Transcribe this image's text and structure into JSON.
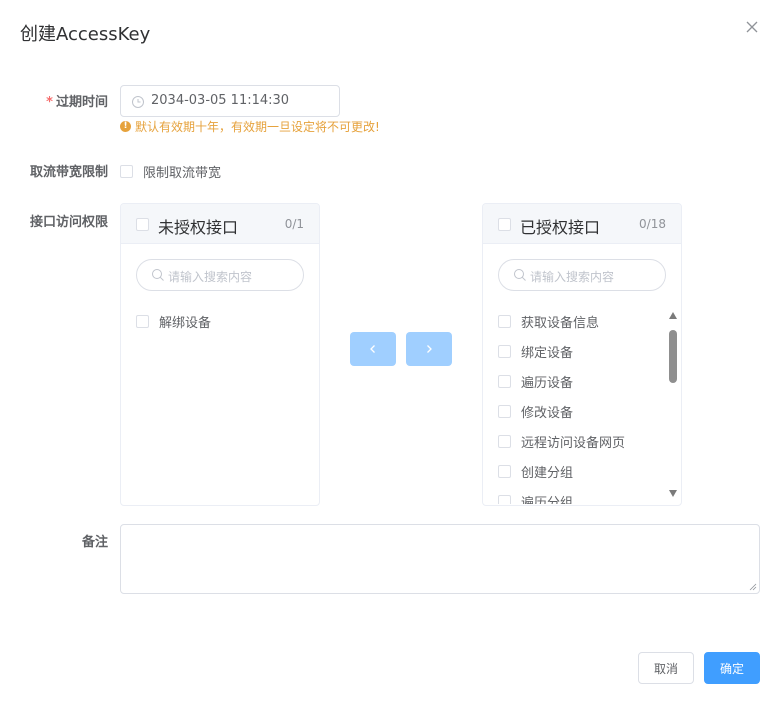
{
  "dialog": {
    "title": "创建AccessKey",
    "close_icon": "close-icon"
  },
  "form": {
    "expire": {
      "required_mark": "*",
      "label": "过期时间",
      "value": "2034-03-05 11:14:30",
      "icon": "clock-icon",
      "warning": "默认有效期十年，有效期一旦设定将不可更改!",
      "warning_icon": "warning-icon",
      "warning_color": "#e6a23c"
    },
    "bandwidth": {
      "label": "取流带宽限制",
      "checkbox_label": "限制取流带宽",
      "checked": false
    },
    "api_access": {
      "label": "接口访问权限",
      "left_panel": {
        "title": "未授权接口",
        "count": "0/1",
        "search_placeholder": "请输入搜索内容",
        "items": [
          "解绑设备"
        ]
      },
      "right_panel": {
        "title": "已授权接口",
        "count": "0/18",
        "search_placeholder": "请输入搜索内容",
        "items": [
          "获取设备信息",
          "绑定设备",
          "遍历设备",
          "修改设备",
          "远程访问设备网页",
          "创建分组",
          "遍历分组"
        ]
      },
      "move_left_icon": "chevron-left-icon",
      "move_right_icon": "chevron-right-icon"
    },
    "remark": {
      "label": "备注",
      "value": ""
    }
  },
  "footer": {
    "cancel_label": "取消",
    "confirm_label": "确定"
  },
  "colors": {
    "primary": "#409eff",
    "primary_disabled": "#a0cfff",
    "required": "#f56c6c"
  }
}
